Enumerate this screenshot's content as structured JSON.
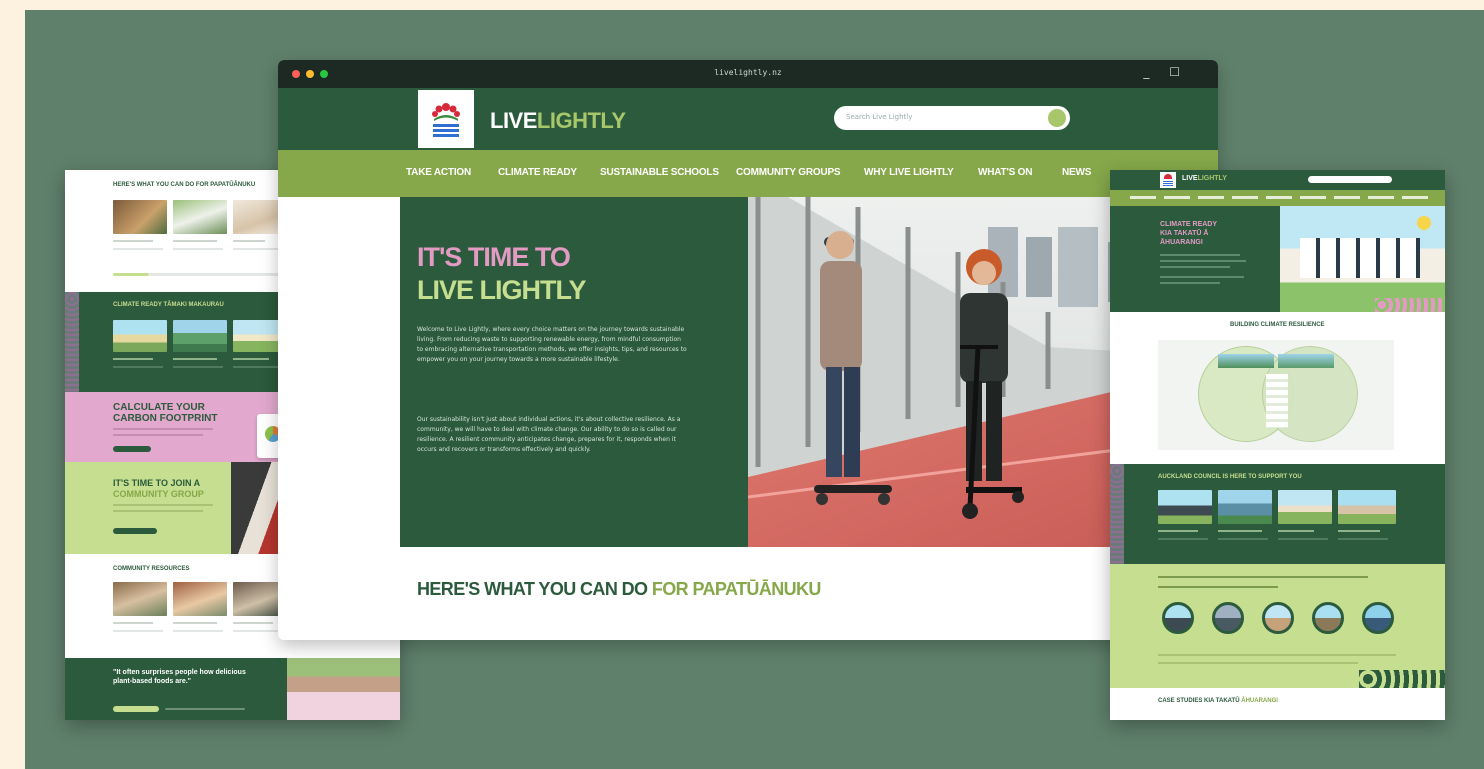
{
  "browser": {
    "url": "livelightly.nz",
    "window_controls": "_ ☐"
  },
  "header": {
    "brand_main": "LIVE",
    "brand_light": "LIGHTLY",
    "search_placeholder": "Search Live Lightly"
  },
  "nav": {
    "items": [
      "TAKE ACTION",
      "CLIMATE READY",
      "SUSTAINABLE SCHOOLS",
      "COMMUNITY GROUPS",
      "WHY LIVE LIGHTLY",
      "WHAT'S ON",
      "NEWS"
    ]
  },
  "hero": {
    "title_line1": "IT'S TIME TO",
    "title_line2": "LIVE LIGHTLY",
    "para1": "Welcome to Live Lightly, where every choice matters on the journey towards sustainable living. From reducing waste to supporting renewable energy, from mindful consumption to embracing alternative transportation methods, we offer insights, tips, and resources to empower you on your journey towards a more sustainable lifestyle.",
    "para2": "Our sustainability isn't just about individual actions, it's about collective resilience. As a community, we will have to deal with climate change. Our ability to do so is called our resilience. A resilient community anticipates change, prepares for it, responds when it occurs and recovers or transforms effectively and quickly."
  },
  "section": {
    "what_you_can_do_main": "HERE'S WHAT YOU CAN DO",
    "what_you_can_do_accent": "FOR PAPATŪĀNUKU"
  },
  "left_page": {
    "what_you_can_do": "HERE'S WHAT YOU CAN DO FOR PAPATŪĀNUKU",
    "climate_ready": "CLIMATE READY TĀMAKI MAKAURAU",
    "calculate_line1": "CALCULATE YOUR",
    "calculate_line2": "CARBON FOOTPRINT",
    "join_line1": "IT'S TIME TO JOIN A",
    "join_line2": "COMMUNITY GROUP",
    "community_resources": "COMMUNITY RESOURCES",
    "quote": "\"It often surprises people how delicious plant-based foods are.\""
  },
  "right_page": {
    "brand_main": "LIVE",
    "brand_light": "LIGHTLY",
    "climate_line1": "CLIMATE READY",
    "climate_line2": "KIA TAKATŪ Ā",
    "climate_line3": "ĀHUARANGI",
    "building_resilience": "BUILDING CLIMATE RESILIENCE",
    "council_support": "AUCKLAND COUNCIL IS HERE TO SUPPORT YOU",
    "case_studies": "CASE STUDIES KIA TAKATŪ",
    "case_studies_accent": "ĀHUARANGI"
  },
  "colors": {
    "dark_green": "#2b5a3c",
    "nav_green": "#86a84a",
    "light_green": "#c6de8f",
    "pink": "#e39bc4",
    "stage": "#5f806b"
  }
}
